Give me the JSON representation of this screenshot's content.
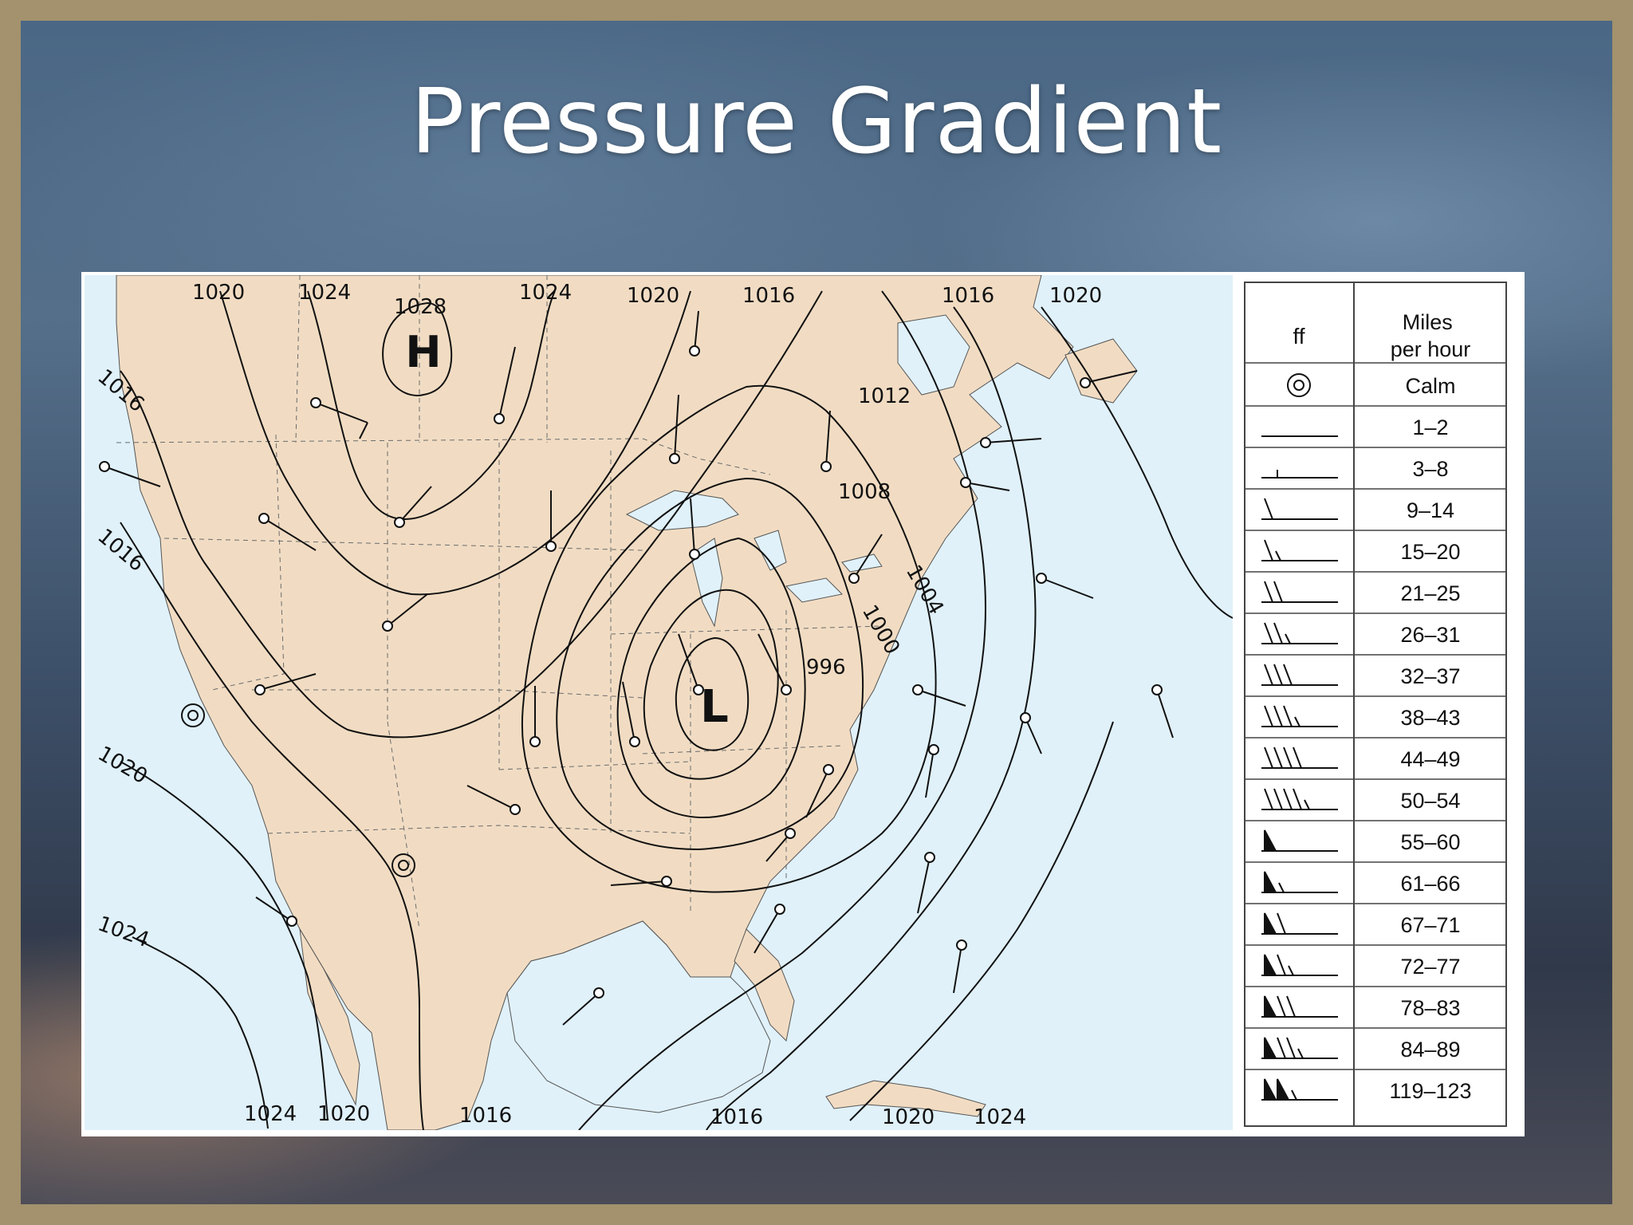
{
  "slide": {
    "title": "Pressure Gradient"
  },
  "map": {
    "high_label": "H",
    "low_label": "L",
    "isobar_labels": {
      "top": [
        "1020",
        "1024",
        "1028",
        "1024",
        "1020",
        "1016",
        "1016",
        "1020"
      ],
      "left": [
        "1016",
        "1016",
        "1020",
        "1024"
      ],
      "bottom": [
        "1024",
        "1020",
        "1016",
        "1016",
        "1020",
        "1024"
      ],
      "inner": [
        "1012",
        "1008",
        "1004",
        "1000",
        "996"
      ]
    },
    "colors": {
      "land": "#f1dcc3",
      "water": "#e0f1fa",
      "high": "#1f6fbd",
      "low": "#e11b1b"
    }
  },
  "legend": {
    "headers": {
      "symbol": "ff",
      "speed": "Miles\nper hour"
    },
    "rows": [
      {
        "symbol": "calm-circle",
        "speed": "Calm"
      },
      {
        "symbol": "shaft",
        "speed": "1–2"
      },
      {
        "symbol": "tick",
        "speed": "3–8"
      },
      {
        "symbol": "barb-1",
        "speed": "9–14"
      },
      {
        "symbol": "barb-1-half",
        "speed": "15–20"
      },
      {
        "symbol": "barb-2",
        "speed": "21–25"
      },
      {
        "symbol": "barb-2-half",
        "speed": "26–31"
      },
      {
        "symbol": "barb-3",
        "speed": "32–37"
      },
      {
        "symbol": "barb-3-half",
        "speed": "38–43"
      },
      {
        "symbol": "barb-4",
        "speed": "44–49"
      },
      {
        "symbol": "barb-4-half",
        "speed": "50–54"
      },
      {
        "symbol": "pennant",
        "speed": "55–60"
      },
      {
        "symbol": "pennant-half",
        "speed": "61–66"
      },
      {
        "symbol": "pennant-1",
        "speed": "67–71"
      },
      {
        "symbol": "pennant-1-half",
        "speed": "72–77"
      },
      {
        "symbol": "pennant-2",
        "speed": "78–83"
      },
      {
        "symbol": "pennant-2-half",
        "speed": "84–89"
      },
      {
        "symbol": "2-pennants-half",
        "speed": "119–123"
      }
    ]
  }
}
